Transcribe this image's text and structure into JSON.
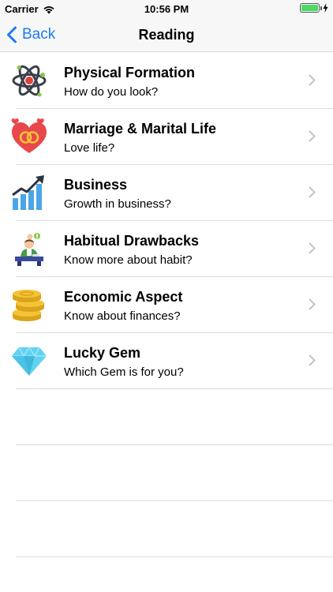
{
  "status_bar": {
    "carrier": "Carrier",
    "time": "10:56 PM",
    "battery_color": "#4cd964"
  },
  "nav": {
    "back_label": "Back",
    "title": "Reading",
    "tint_color": "#1a7bf0"
  },
  "items": [
    {
      "title": "Physical Formation",
      "subtitle": "How do you look?",
      "icon": "atom-icon"
    },
    {
      "title": "Marriage & Marital Life",
      "subtitle": "Love life?",
      "icon": "hearts-rings-icon"
    },
    {
      "title": "Business",
      "subtitle": "Growth in business?",
      "icon": "growth-chart-icon"
    },
    {
      "title": "Habitual Drawbacks",
      "subtitle": "Know more about habit?",
      "icon": "person-desk-icon"
    },
    {
      "title": "Economic Aspect",
      "subtitle": "Know about finances?",
      "icon": "coins-icon"
    },
    {
      "title": "Lucky Gem",
      "subtitle": "Which Gem is for you?",
      "icon": "diamond-icon"
    }
  ]
}
